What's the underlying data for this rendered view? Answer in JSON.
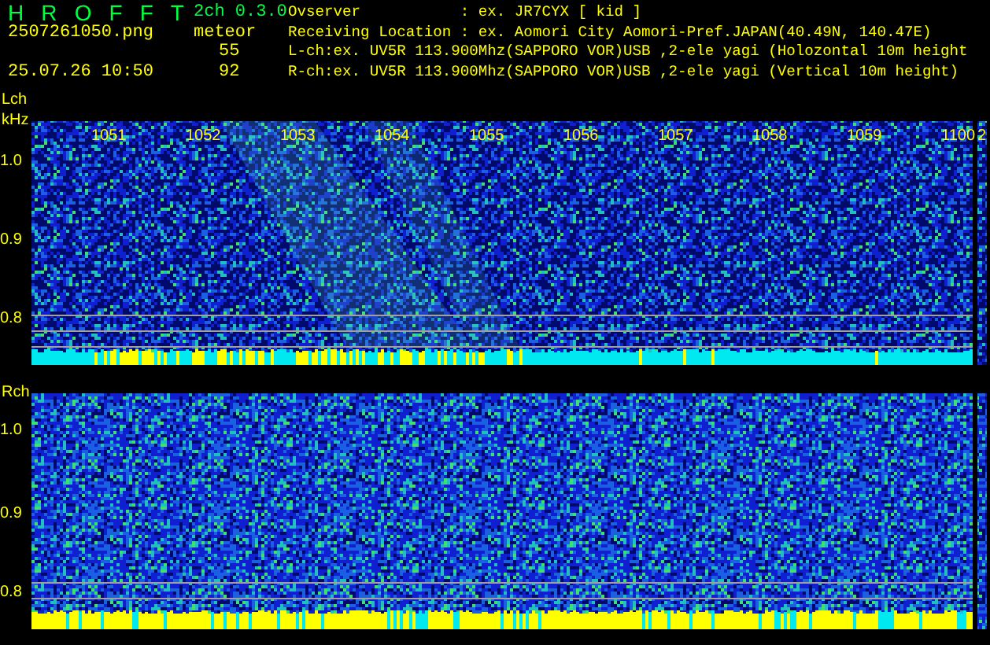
{
  "header": {
    "title_letters": [
      "H",
      "R",
      "O",
      "F",
      "F",
      "T"
    ],
    "filename": "2507261050.png",
    "datetime": "25.07.26 10:50",
    "version": "2ch 0.3.0",
    "count_label": "meteor",
    "counts": [
      "55",
      "92"
    ]
  },
  "info_lines": [
    "Ovserver           : ex. JR7CYX [ kid ]",
    "Receiving Location : ex. Aomori City Aomori-Pref.JAPAN(40.49N, 140.47E)",
    "L-ch:ex. UV5R 113.900Mhz(SAPPORO VOR)USB ,2-ele yagi (Holozontal 10m height",
    "R-ch:ex. UV5R 113.900Mhz(SAPPORO VOR)USB ,2-ele yagi (Vertical 10m height)"
  ],
  "channels": [
    {
      "label": "Lch",
      "unit": "kHz",
      "time_labels": [
        "1051",
        "1052",
        "1053",
        "1054",
        "1055",
        "1056",
        "1057",
        "1058",
        "1059",
        "1100",
        "2"
      ],
      "freq_labels": [
        "1.0",
        "0.9",
        "0.8"
      ]
    },
    {
      "label": "Rch",
      "freq_labels": [
        "1.0",
        "0.9",
        "0.8"
      ]
    }
  ]
}
